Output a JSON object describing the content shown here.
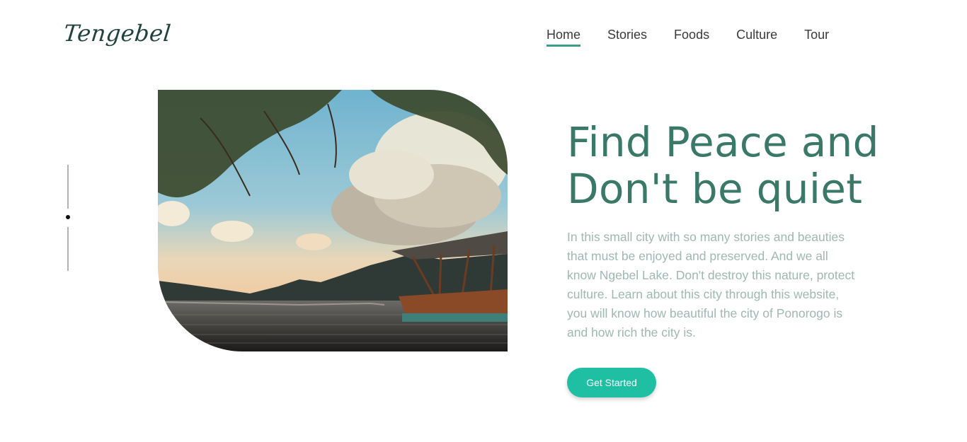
{
  "brand": {
    "logo_text": "Tengebel"
  },
  "nav": {
    "items": [
      {
        "label": "Home",
        "active": true
      },
      {
        "label": "Stories",
        "active": false
      },
      {
        "label": "Foods",
        "active": false
      },
      {
        "label": "Culture",
        "active": false
      },
      {
        "label": "Tour",
        "active": false
      }
    ]
  },
  "hero": {
    "title_line1": "Find Peace and",
    "title_line2": "Don't be quiet",
    "description": "In this small city with so many stories and beauties that must be enjoyed and preserved. And we all know Ngebel Lake. Don't destroy this nature, protect culture. Learn about this city through this website, you will know how beautiful the city of Ponorogo is and how rich the city is.",
    "cta_label": "Get Started"
  },
  "colors": {
    "accent": "#1fbfa3",
    "title": "#3a7868",
    "nav_underline": "#3a9e88",
    "body_text": "#9fb8b2"
  },
  "slider": {
    "active_index": 1
  }
}
